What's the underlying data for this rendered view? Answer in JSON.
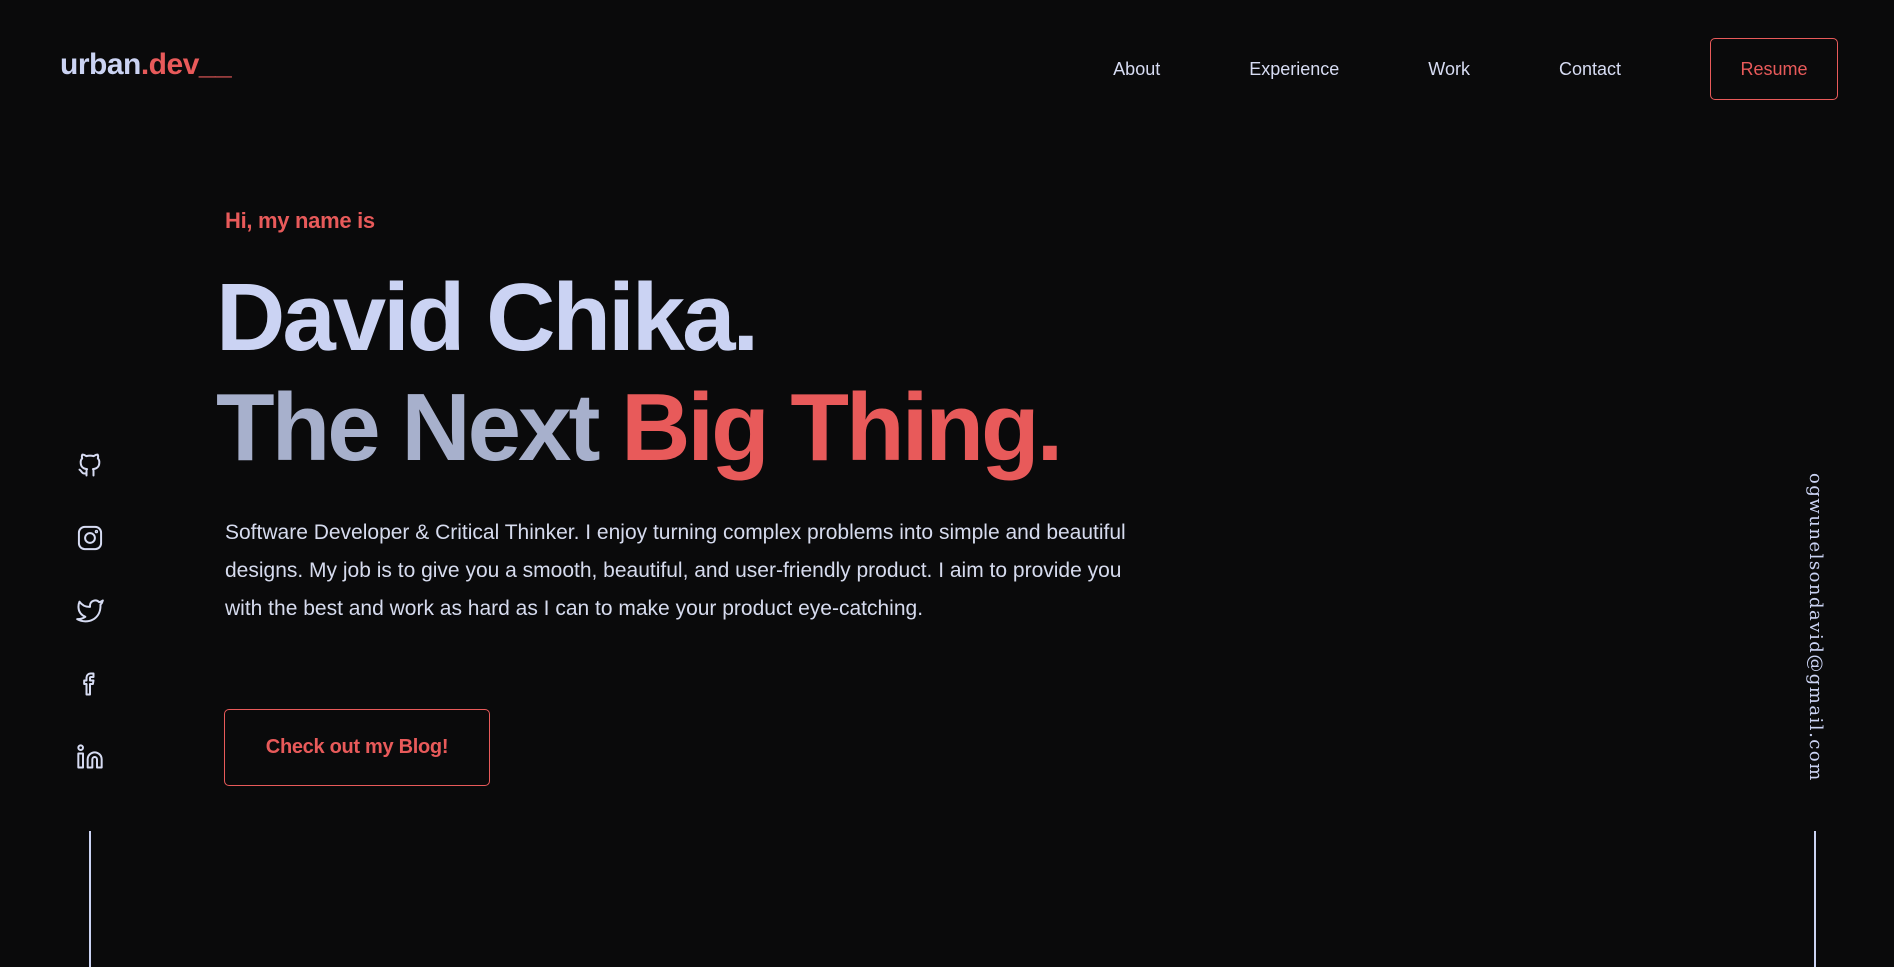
{
  "header": {
    "logo_main": "urban",
    "logo_accent": ".dev__",
    "nav": [
      {
        "label": "About"
      },
      {
        "label": "Experience"
      },
      {
        "label": "Work"
      },
      {
        "label": "Contact"
      }
    ],
    "resume_label": "Resume"
  },
  "hero": {
    "greeting": "Hi, my name is",
    "name": "David Chika.",
    "tagline_part1": "The Next ",
    "tagline_accent": "Big Thing.",
    "bio": "Software Developer & Critical Thinker. I enjoy turning complex problems into simple and beautiful designs. My job is to give you a smooth, beautiful, and user-friendly product. I aim to provide you with the best and work as hard as I can to make your product eye-catching.",
    "cta_label": "Check out my Blog!"
  },
  "social": [
    "github-icon",
    "instagram-icon",
    "twitter-icon",
    "facebook-icon",
    "linkedin-icon"
  ],
  "email": "ogwunelsondavid@gmail.com",
  "colors": {
    "background": "#0a0a0b",
    "accent": "#e85a5a",
    "text_light": "#cbd3f3",
    "text_muted": "#a7b0cc"
  }
}
